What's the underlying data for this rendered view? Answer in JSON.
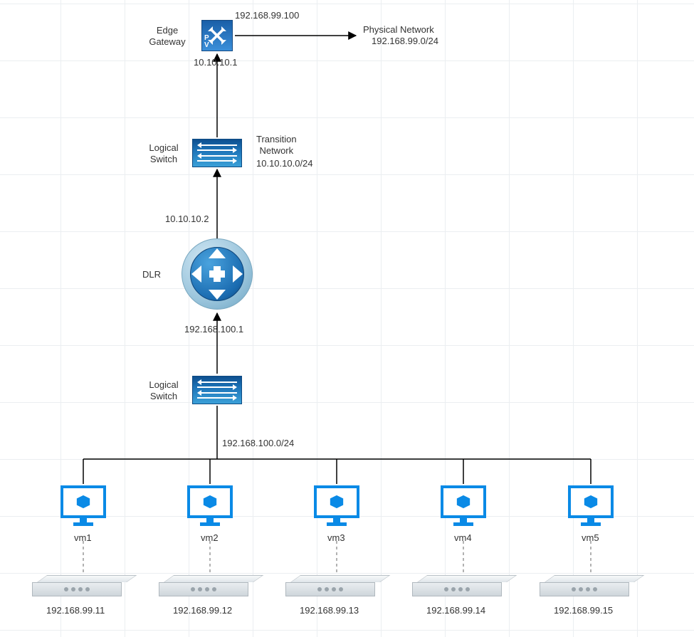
{
  "edge": {
    "label": "Edge\nGateway",
    "outside_ip": "192.168.99.100",
    "inside_ip": "10.10.10.1"
  },
  "physical_network": {
    "label": "Physical Network",
    "subnet": "192.168.99.0/24"
  },
  "transition": {
    "switch_label": "Logical\nSwitch",
    "label": "Transition\nNetwork",
    "subnet": "10.10.10.0/24"
  },
  "dlr": {
    "label": "DLR",
    "uplink_ip": "10.10.10.2",
    "downlink_ip": "192.168.100.1"
  },
  "vm_switch": {
    "label": "Logical\nSwitch",
    "subnet": "192.168.100.0/24"
  },
  "vms": [
    {
      "name": "vm1",
      "host_ip": "192.168.99.11"
    },
    {
      "name": "vm2",
      "host_ip": "192.168.99.12"
    },
    {
      "name": "vm3",
      "host_ip": "192.168.99.13"
    },
    {
      "name": "vm4",
      "host_ip": "192.168.99.14"
    },
    {
      "name": "vm5",
      "host_ip": "192.168.99.15"
    }
  ]
}
